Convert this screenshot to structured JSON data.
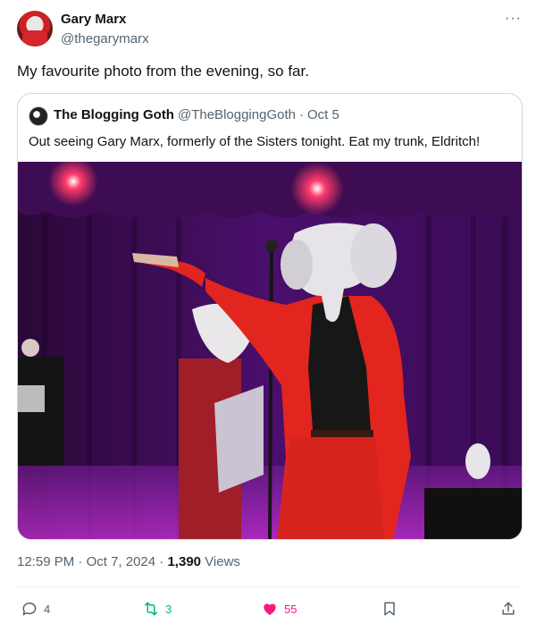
{
  "author": {
    "name": "Gary Marx",
    "handle": "@thegarymarx"
  },
  "post": {
    "text": "My favourite photo from the evening, so far."
  },
  "quoted": {
    "name": "The Blogging Goth",
    "handle": "@TheBloggingGoth",
    "separator": "·",
    "date": "Oct 5",
    "text": "Out seeing Gary Marx, formerly of the Sisters tonight. Eat my trunk, Eldritch!"
  },
  "meta": {
    "time": "12:59 PM",
    "separator": "·",
    "date": "Oct 7, 2024",
    "separator2": "·",
    "views_count": "1,390",
    "views_label": "Views"
  },
  "actions": {
    "reply_count": "4",
    "retweet_count": "3",
    "like_count": "55"
  },
  "more_label": "···",
  "colors": {
    "retweet": "#00ba7c",
    "like": "#f91880",
    "secondary": "#536471"
  },
  "icons": [
    "more-icon",
    "reply-icon",
    "retweet-icon",
    "like-icon",
    "bookmark-icon",
    "share-icon"
  ]
}
